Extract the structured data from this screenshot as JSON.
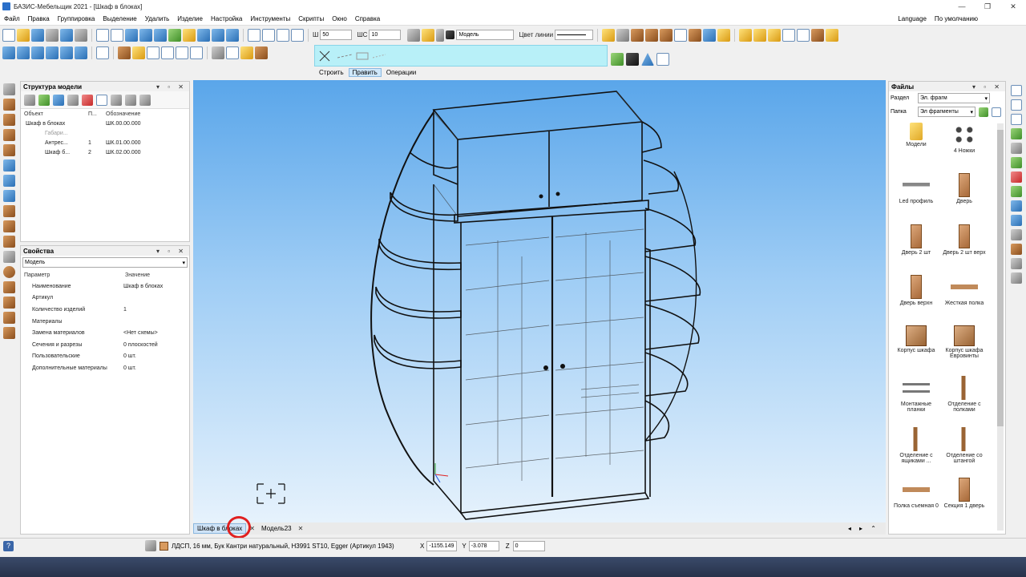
{
  "window": {
    "title": "БАЗИС-Мебельщик 2021 - [Шкаф в блоках]",
    "min": "—",
    "max": "❐",
    "close": "✕"
  },
  "menu": [
    "Файл",
    "Правка",
    "Группировка",
    "Выделение",
    "Удалить",
    "Изделие",
    "Настройка",
    "Инструменты",
    "Скрипты",
    "Окно",
    "Справка"
  ],
  "menu_right": {
    "language": "Language",
    "default": "По умолчанию"
  },
  "toolbar": {
    "w_label": "Ш",
    "w_value": "50",
    "ws_label": "ШС",
    "ws_value": "10",
    "layer_value": "Модель",
    "line_color_label": "Цвет линии"
  },
  "mode_tabs": [
    "Строить",
    "Править",
    "Операции"
  ],
  "structure": {
    "title": "Структура модели",
    "columns": [
      "Объект",
      "П...",
      "Обозначение"
    ],
    "rows": [
      {
        "name": "Шкаф в блоках",
        "n": "",
        "code": "ШК.00.00.000"
      },
      {
        "name": "Габари...",
        "n": "",
        "code": ""
      },
      {
        "name": "Антрес...",
        "n": "1",
        "code": "ШК.01.00.000"
      },
      {
        "name": "Шкаф б...",
        "n": "2",
        "code": "ШК.02.00.000"
      }
    ]
  },
  "properties": {
    "title": "Свойства",
    "selector": "Модель",
    "columns": [
      "Параметр",
      "Значение"
    ],
    "rows": [
      {
        "param": "Наименование",
        "value": "Шкаф в блоках"
      },
      {
        "param": "Артикул",
        "value": ""
      },
      {
        "param": "Количество изделий",
        "value": "1"
      },
      {
        "param": "Материалы",
        "value": ""
      },
      {
        "param": "Замена материалов",
        "value": "<Нет схемы>"
      },
      {
        "param": "Сечения и разрезы",
        "value": "0 плоскостей"
      },
      {
        "param": "Пользовательские",
        "value": "0 шт."
      },
      {
        "param": "Дополнительные материалы",
        "value": "0 шт."
      }
    ]
  },
  "files": {
    "title": "Файлы",
    "section_label": "Раздел",
    "section_value": "Эл. фрагм",
    "folder_label": "Папка",
    "folder_value": "Эл фрагменты",
    "items": [
      {
        "label": "Модели",
        "icon": "folder-icon"
      },
      {
        "label": "4 Ножки",
        "icon": "legs-icon"
      },
      {
        "label": "Led профиль",
        "icon": "profile-icon"
      },
      {
        "label": "Дверь",
        "icon": "door-icon"
      },
      {
        "label": "Дверь 2 шт",
        "icon": "door-icon"
      },
      {
        "label": "Дверь 2 шт верх",
        "icon": "door-icon"
      },
      {
        "label": "Дверь верхн",
        "icon": "door-icon"
      },
      {
        "label": "Жесткая полка",
        "icon": "shelf-icon"
      },
      {
        "label": "Корпус шкафа",
        "icon": "cabinet-icon"
      },
      {
        "label": "Корпус шкафа Евровинты",
        "icon": "cabinet-icon"
      },
      {
        "label": "Монтажные планки",
        "icon": "plank-icon"
      },
      {
        "label": "Отделение с полками",
        "icon": "section-icon"
      },
      {
        "label": "Отделение с ящиками ...",
        "icon": "section-icon"
      },
      {
        "label": "Отделение со штангой",
        "icon": "section-icon"
      },
      {
        "label": "Полка съемная 0",
        "icon": "shelf-icon"
      },
      {
        "label": "Секция 1 дверь",
        "icon": "door-icon"
      }
    ]
  },
  "doc_tabs": [
    {
      "label": "Шкаф в блоках",
      "active": true
    },
    {
      "label": "Модель23",
      "active": false
    }
  ],
  "status": {
    "material": "ЛДСП, 16 мм, Бук Кантри натуральный, H3991 ST10, Egger (Артикул 1943)",
    "x_label": "X",
    "x": "-1155.149",
    "y_label": "Y",
    "y": "-3.078",
    "z_label": "Z",
    "z": "0"
  },
  "colors": {
    "viewport_top": "#5aa6ea",
    "viewport_bottom": "#e6f2fc",
    "accent": "#1e6fd9"
  }
}
